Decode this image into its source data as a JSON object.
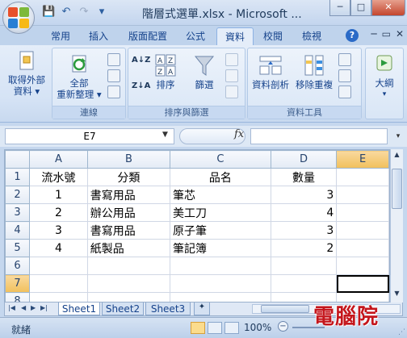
{
  "window": {
    "title": "階層式選單.xlsx - Microsoft ...",
    "min_label": "─",
    "max_label": "□",
    "close_label": "✕"
  },
  "qat": {
    "save_icon": "💾",
    "undo_icon": "↶",
    "redo_icon": "↷",
    "customize_icon": "▾"
  },
  "tabs": [
    {
      "label": "常用"
    },
    {
      "label": "插入"
    },
    {
      "label": "版面配置"
    },
    {
      "label": "公式"
    },
    {
      "label": "資料"
    },
    {
      "label": "校閱"
    },
    {
      "label": "檢視"
    }
  ],
  "active_tab": "資料",
  "help_label": "?",
  "ribbon": {
    "groups": [
      {
        "label": "連線"
      },
      {
        "label": "排序與篩選"
      },
      {
        "label": "資料工具"
      }
    ],
    "buttons": {
      "get_external": "取得外部\n資料 ▾",
      "refresh_all": "全部\n重新整理 ▾",
      "sort": "排序",
      "filter": "篩選",
      "text_to_columns": "資料剖析",
      "remove_duplicates": "移除重複",
      "outline": "大綱",
      "sort_az": "A↓Z",
      "sort_za": "Z↓A"
    }
  },
  "formula_bar": {
    "name_box": "E7",
    "fx_label": "fx",
    "formula": ""
  },
  "grid": {
    "columns": [
      "A",
      "B",
      "C",
      "D",
      "E"
    ],
    "selected_column": "E",
    "selected_row": "7",
    "rows": [
      {
        "num": "1",
        "cells": [
          "流水號",
          "分類",
          "品名",
          "數量",
          ""
        ]
      },
      {
        "num": "2",
        "cells": [
          "1",
          "書寫用品",
          "筆芯",
          "3",
          ""
        ]
      },
      {
        "num": "3",
        "cells": [
          "2",
          "辦公用品",
          "美工刀",
          "4",
          ""
        ]
      },
      {
        "num": "4",
        "cells": [
          "3",
          "書寫用品",
          "原子筆",
          "3",
          ""
        ]
      },
      {
        "num": "5",
        "cells": [
          "4",
          "紙製品",
          "筆記簿",
          "2",
          ""
        ]
      },
      {
        "num": "6",
        "cells": [
          "",
          "",
          "",
          "",
          ""
        ]
      },
      {
        "num": "7",
        "cells": [
          "",
          "",
          "",
          "",
          ""
        ]
      },
      {
        "num": "8",
        "cells": [
          "",
          "",
          "",
          "",
          ""
        ]
      }
    ]
  },
  "sheets": [
    {
      "label": "Sheet1"
    },
    {
      "label": "Sheet2"
    },
    {
      "label": "Sheet3"
    }
  ],
  "active_sheet": "Sheet1",
  "status": {
    "ready": "就緒",
    "zoom": "100%",
    "zoom_minus": "−"
  },
  "watermark": "電腦院"
}
